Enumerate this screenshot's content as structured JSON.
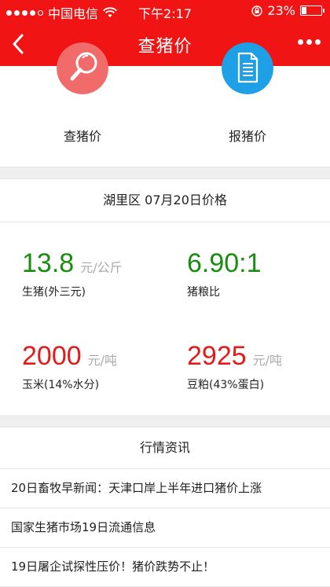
{
  "status_bar": {
    "carrier": "中国电信",
    "time": "下午2:17",
    "battery": "23%",
    "battery_level": 0.23
  },
  "nav": {
    "title": "查猪价",
    "back_icon": "chevron-left-icon",
    "more_icon": "more-dots-icon"
  },
  "actions": [
    {
      "label": "查猪价",
      "icon": "magnifier-icon",
      "color": "#f26b6b"
    },
    {
      "label": "报猪价",
      "icon": "document-icon",
      "color": "#1ea0e6"
    }
  ],
  "price": {
    "header": "湖里区  07月20日价格",
    "items": [
      {
        "value": "13.8",
        "unit": "元/公斤",
        "label": "生猪(外三元)",
        "color": "green"
      },
      {
        "value": "6.90:1",
        "unit": "",
        "label": "猪粮比",
        "color": "green"
      },
      {
        "value": "2000",
        "unit": "元/吨",
        "label": "玉米(14%水分)",
        "color": "red"
      },
      {
        "value": "2925",
        "unit": "元/吨",
        "label": "豆粕(43%蛋白)",
        "color": "red"
      }
    ]
  },
  "news": {
    "header": "行情资讯",
    "items": [
      "20日畜牧早新闻：天津口岸上半年进口猪价上涨",
      "国家生猪市场19日流通信息",
      "19日屠企试探性压价！猪价跌势不止！"
    ]
  },
  "colors": {
    "brand_red": "#f01414",
    "value_green": "#1a8c12",
    "value_red": "#e31b1b"
  }
}
